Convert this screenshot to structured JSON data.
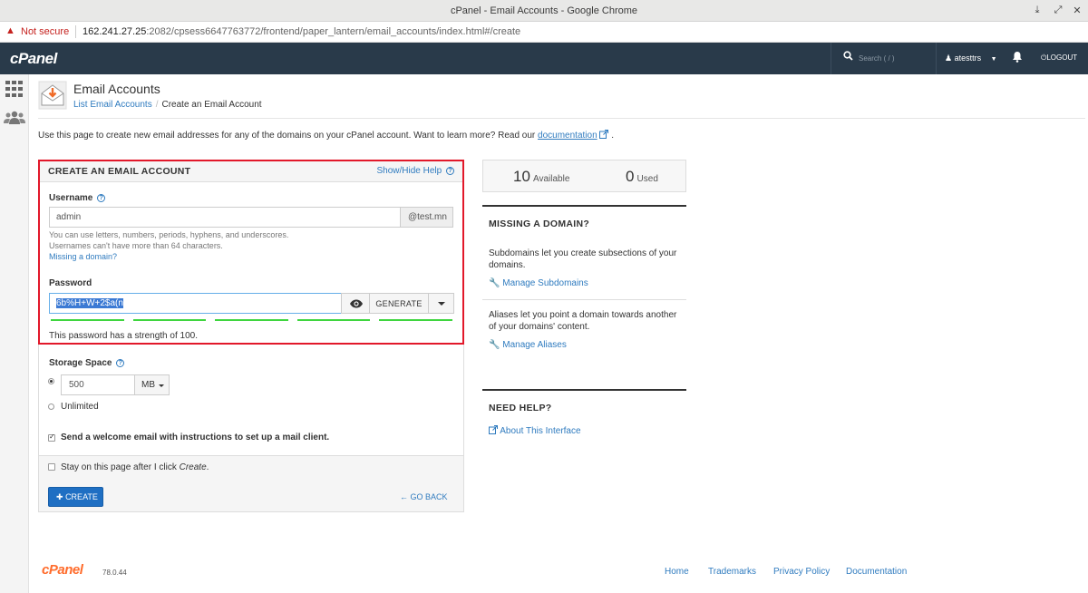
{
  "window": {
    "title": "cPanel - Email Accounts - Google Chrome"
  },
  "urlbar": {
    "security": "Not secure",
    "host": "162.241.27.25",
    "path": ":2082/cpsess6647763772/frontend/paper_lantern/email_accounts/index.html#/create"
  },
  "topnav": {
    "logo": "cPanel",
    "search_placeholder": "Search ( / )",
    "user": "atesttrs",
    "logout": "LOGOUT"
  },
  "header": {
    "title": "Email Accounts",
    "breadcrumb_link": "List Email Accounts",
    "breadcrumb_current": "Create an Email Account"
  },
  "intro": {
    "text": "Use this page to create new email addresses for any of the domains on your cPanel account. Want to learn more? Read our",
    "link": "documentation",
    "end": "."
  },
  "form": {
    "title": "CREATE AN EMAIL ACCOUNT",
    "help_toggle": "Show/Hide Help",
    "username_label": "Username",
    "username_value": "admin",
    "domain": "@test.mn",
    "hint1": "You can use letters, numbers, periods, hyphens, and underscores.",
    "hint2": "Usernames can't have more than 64 characters.",
    "missing_domain": "Missing a domain?",
    "password_label": "Password",
    "password_value": "6b%H+W+2$a(n",
    "generate": "GENERATE",
    "strength_text": "This password has a strength of 100.",
    "strength_segments": 5,
    "storage_label": "Storage Space",
    "storage_value": "500",
    "storage_unit": "MB",
    "unlimited": "Unlimited",
    "welcome_email": "Send a welcome email with instructions to set up a mail client.",
    "stay_prefix": "Stay on this page after I click",
    "stay_action": "Create",
    "stay_suffix": ".",
    "create": "CREATE",
    "go_back": "GO BACK"
  },
  "stats": {
    "available_count": "10",
    "available_label": "Available",
    "used_count": "0",
    "used_label": "Used"
  },
  "missing_domain": {
    "title": "MISSING A DOMAIN?",
    "subdomains_text": "Subdomains let you create subsections of your domains.",
    "subdomains_link": "Manage Subdomains",
    "aliases_text": "Aliases let you point a domain towards another of your domains' content.",
    "aliases_link": "Manage Aliases"
  },
  "need_help": {
    "title": "NEED HELP?",
    "link": "About This Interface"
  },
  "footer": {
    "logo": "cPanel",
    "version": "78.0.44",
    "links": [
      "Home",
      "Trademarks",
      "Privacy Policy",
      "Documentation"
    ]
  },
  "colors": {
    "nav_bg": "#293a4a",
    "link": "#2f7bbf",
    "highlight": "#e2182a",
    "strength": "#3fd53f",
    "primary_button": "#1f6fc3",
    "footer_logo": "#ff6c2c"
  }
}
